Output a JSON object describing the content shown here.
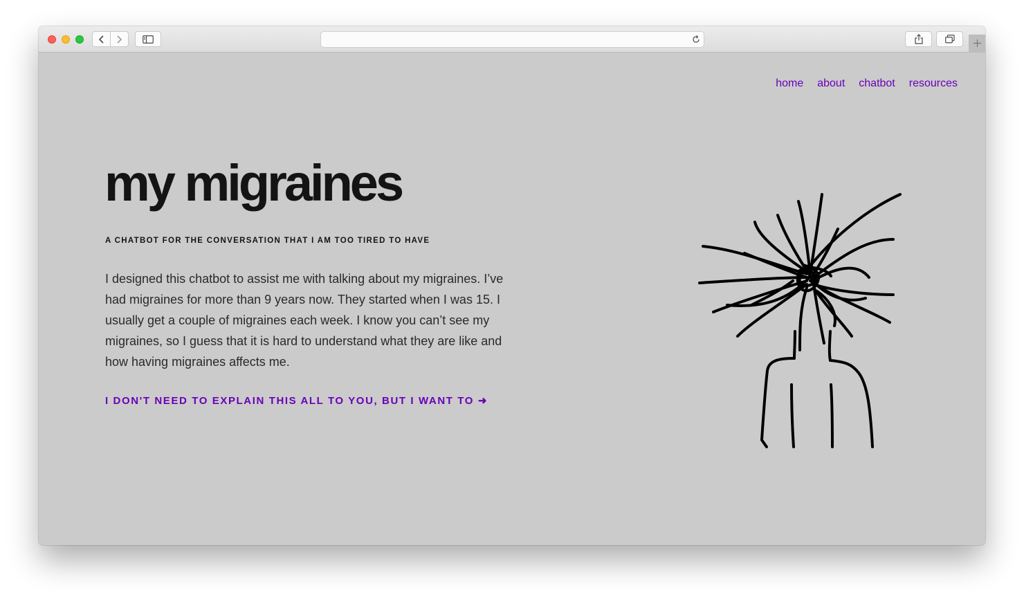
{
  "browser": {
    "address_text": "",
    "icons": {
      "back": "chevron-left-icon",
      "forward": "chevron-right-icon",
      "sidebar": "sidebar-icon",
      "reload": "reload-icon",
      "share": "share-icon",
      "tabs": "tabs-overview-icon",
      "new_tab": "plus-icon"
    }
  },
  "nav": {
    "items": [
      {
        "label": "home"
      },
      {
        "label": "about"
      },
      {
        "label": "chatbot"
      },
      {
        "label": "resources"
      }
    ]
  },
  "hero": {
    "title": "my migraines",
    "subtitle": "A CHATBOT FOR THE CONVERSATION THAT I AM TOO TIRED TO HAVE",
    "intro": "I designed this chatbot to assist me with talking about my migraines. I’ve had migraines for more than 9 years now. They started when I was 15. I usually get a couple of migraines each week. I know you can’t see my migraines, so I guess that it is hard to understand what they are like and how having migraines affects me.",
    "cta": "I DON'T NEED TO EXPLAIN THIS ALL TO YOU, BUT I WANT TO ➜",
    "illustration": "scribbled-head-figure"
  },
  "colors": {
    "accent": "#6a00b8",
    "page_background": "#cbcbcb",
    "text": "#141414"
  }
}
